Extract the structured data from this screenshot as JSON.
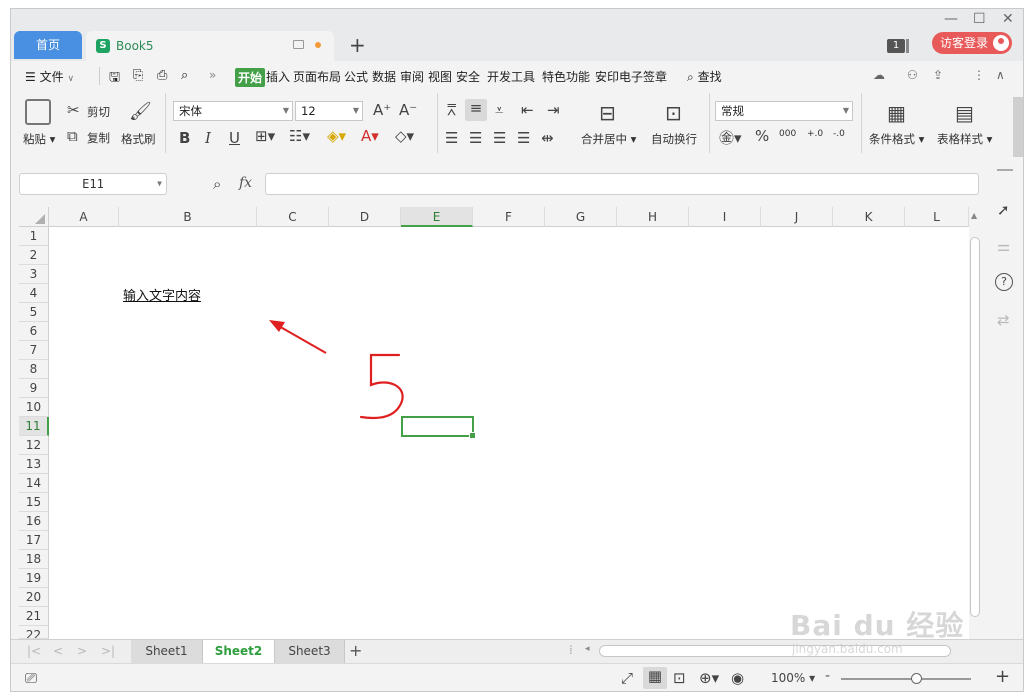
{
  "titlebar": {
    "home_tab": "首页",
    "doc_tab": "Book5",
    "new_tab_symbol": "+",
    "badge": "1",
    "guest_login": "访客登录"
  },
  "menu": {
    "file": "文件",
    "more": "»",
    "tabs": [
      "开始",
      "插入",
      "页面布局",
      "公式",
      "数据",
      "审阅",
      "视图",
      "安全",
      "开发工具",
      "特色功能",
      "安印电子签章"
    ],
    "active_tab": "开始",
    "search": "查找"
  },
  "ribbon": {
    "paste": "粘贴",
    "cut": "剪切",
    "copy": "复制",
    "format_painter": "格式刷",
    "font_name": "宋体",
    "font_size": "12",
    "bold": "B",
    "italic": "I",
    "underline": "U",
    "merge_center": "合并居中",
    "auto_wrap": "自动换行",
    "number_format": "常规",
    "percent": "%",
    "thousands": "000",
    "dec_inc": "+.0",
    "dec_dec": "-.0",
    "conditional_format": "条件格式",
    "table_style": "表格样式"
  },
  "formula_bar": {
    "name_box": "E11",
    "fx": "fx",
    "content": ""
  },
  "grid": {
    "columns": [
      "A",
      "B",
      "C",
      "D",
      "E",
      "F",
      "G",
      "H",
      "I",
      "J",
      "K",
      "L"
    ],
    "selected_column": "E",
    "rows": [
      "1",
      "2",
      "3",
      "4",
      "5",
      "6",
      "7",
      "8",
      "9",
      "10",
      "11",
      "12",
      "13",
      "14",
      "15",
      "16",
      "17",
      "18",
      "19",
      "20",
      "21",
      "22"
    ],
    "selected_row": "11",
    "cell_B4": "输入文字内容"
  },
  "annotation": {
    "handwritten_number": "5",
    "color": "#e02020"
  },
  "sheets": {
    "tabs": [
      "Sheet1",
      "Sheet2",
      "Sheet3"
    ],
    "active": "Sheet2",
    "add": "+"
  },
  "status": {
    "zoom": "100%",
    "zoom_in": "+",
    "zoom_out": "-"
  },
  "watermark": {
    "brand": "Bai du 经验",
    "url": "jingyan.baidu.com"
  },
  "colors": {
    "accent_green": "#43a047",
    "home_tab_blue": "#4a90e2",
    "guest_red": "#e85a5a"
  }
}
